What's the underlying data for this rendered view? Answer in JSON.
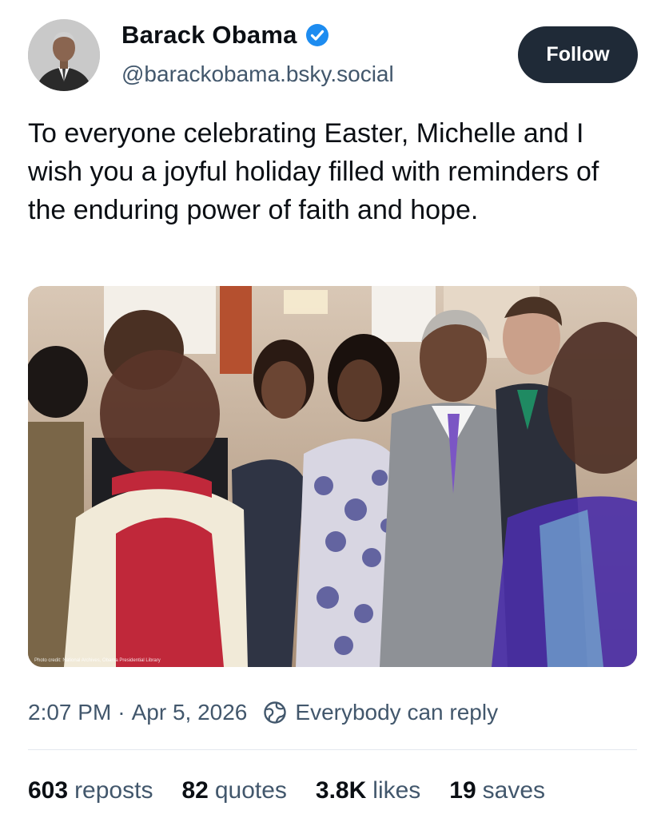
{
  "author": {
    "display_name": "Barack Obama",
    "handle": "@barackobama.bsky.social",
    "verified": true,
    "verified_icon": "verified-check-icon",
    "verified_color": "#1d8cf0"
  },
  "actions": {
    "follow_label": "Follow"
  },
  "post": {
    "text": "To everyone celebrating Easter, Michelle and I wish you a joyful holiday filled with reminders of the enduring power of faith and hope.",
    "image": {
      "credit": "Photo credit: National Archives, Obama Presidential Library"
    }
  },
  "meta": {
    "time": "2:07 PM",
    "separator": "·",
    "date": "Apr 5, 2026",
    "reply_icon": "globe-reply-icon",
    "reply_setting": "Everybody can reply"
  },
  "stats": {
    "reposts": {
      "count": "603",
      "label": "reposts"
    },
    "quotes": {
      "count": "82",
      "label": "quotes"
    },
    "likes": {
      "count": "3.8K",
      "label": "likes"
    },
    "saves": {
      "count": "19",
      "label": "saves"
    }
  },
  "colors": {
    "text_primary": "#0b0f14",
    "text_secondary": "#42576c",
    "follow_button_bg": "#1f2a37",
    "divider": "#e3e8ee"
  }
}
